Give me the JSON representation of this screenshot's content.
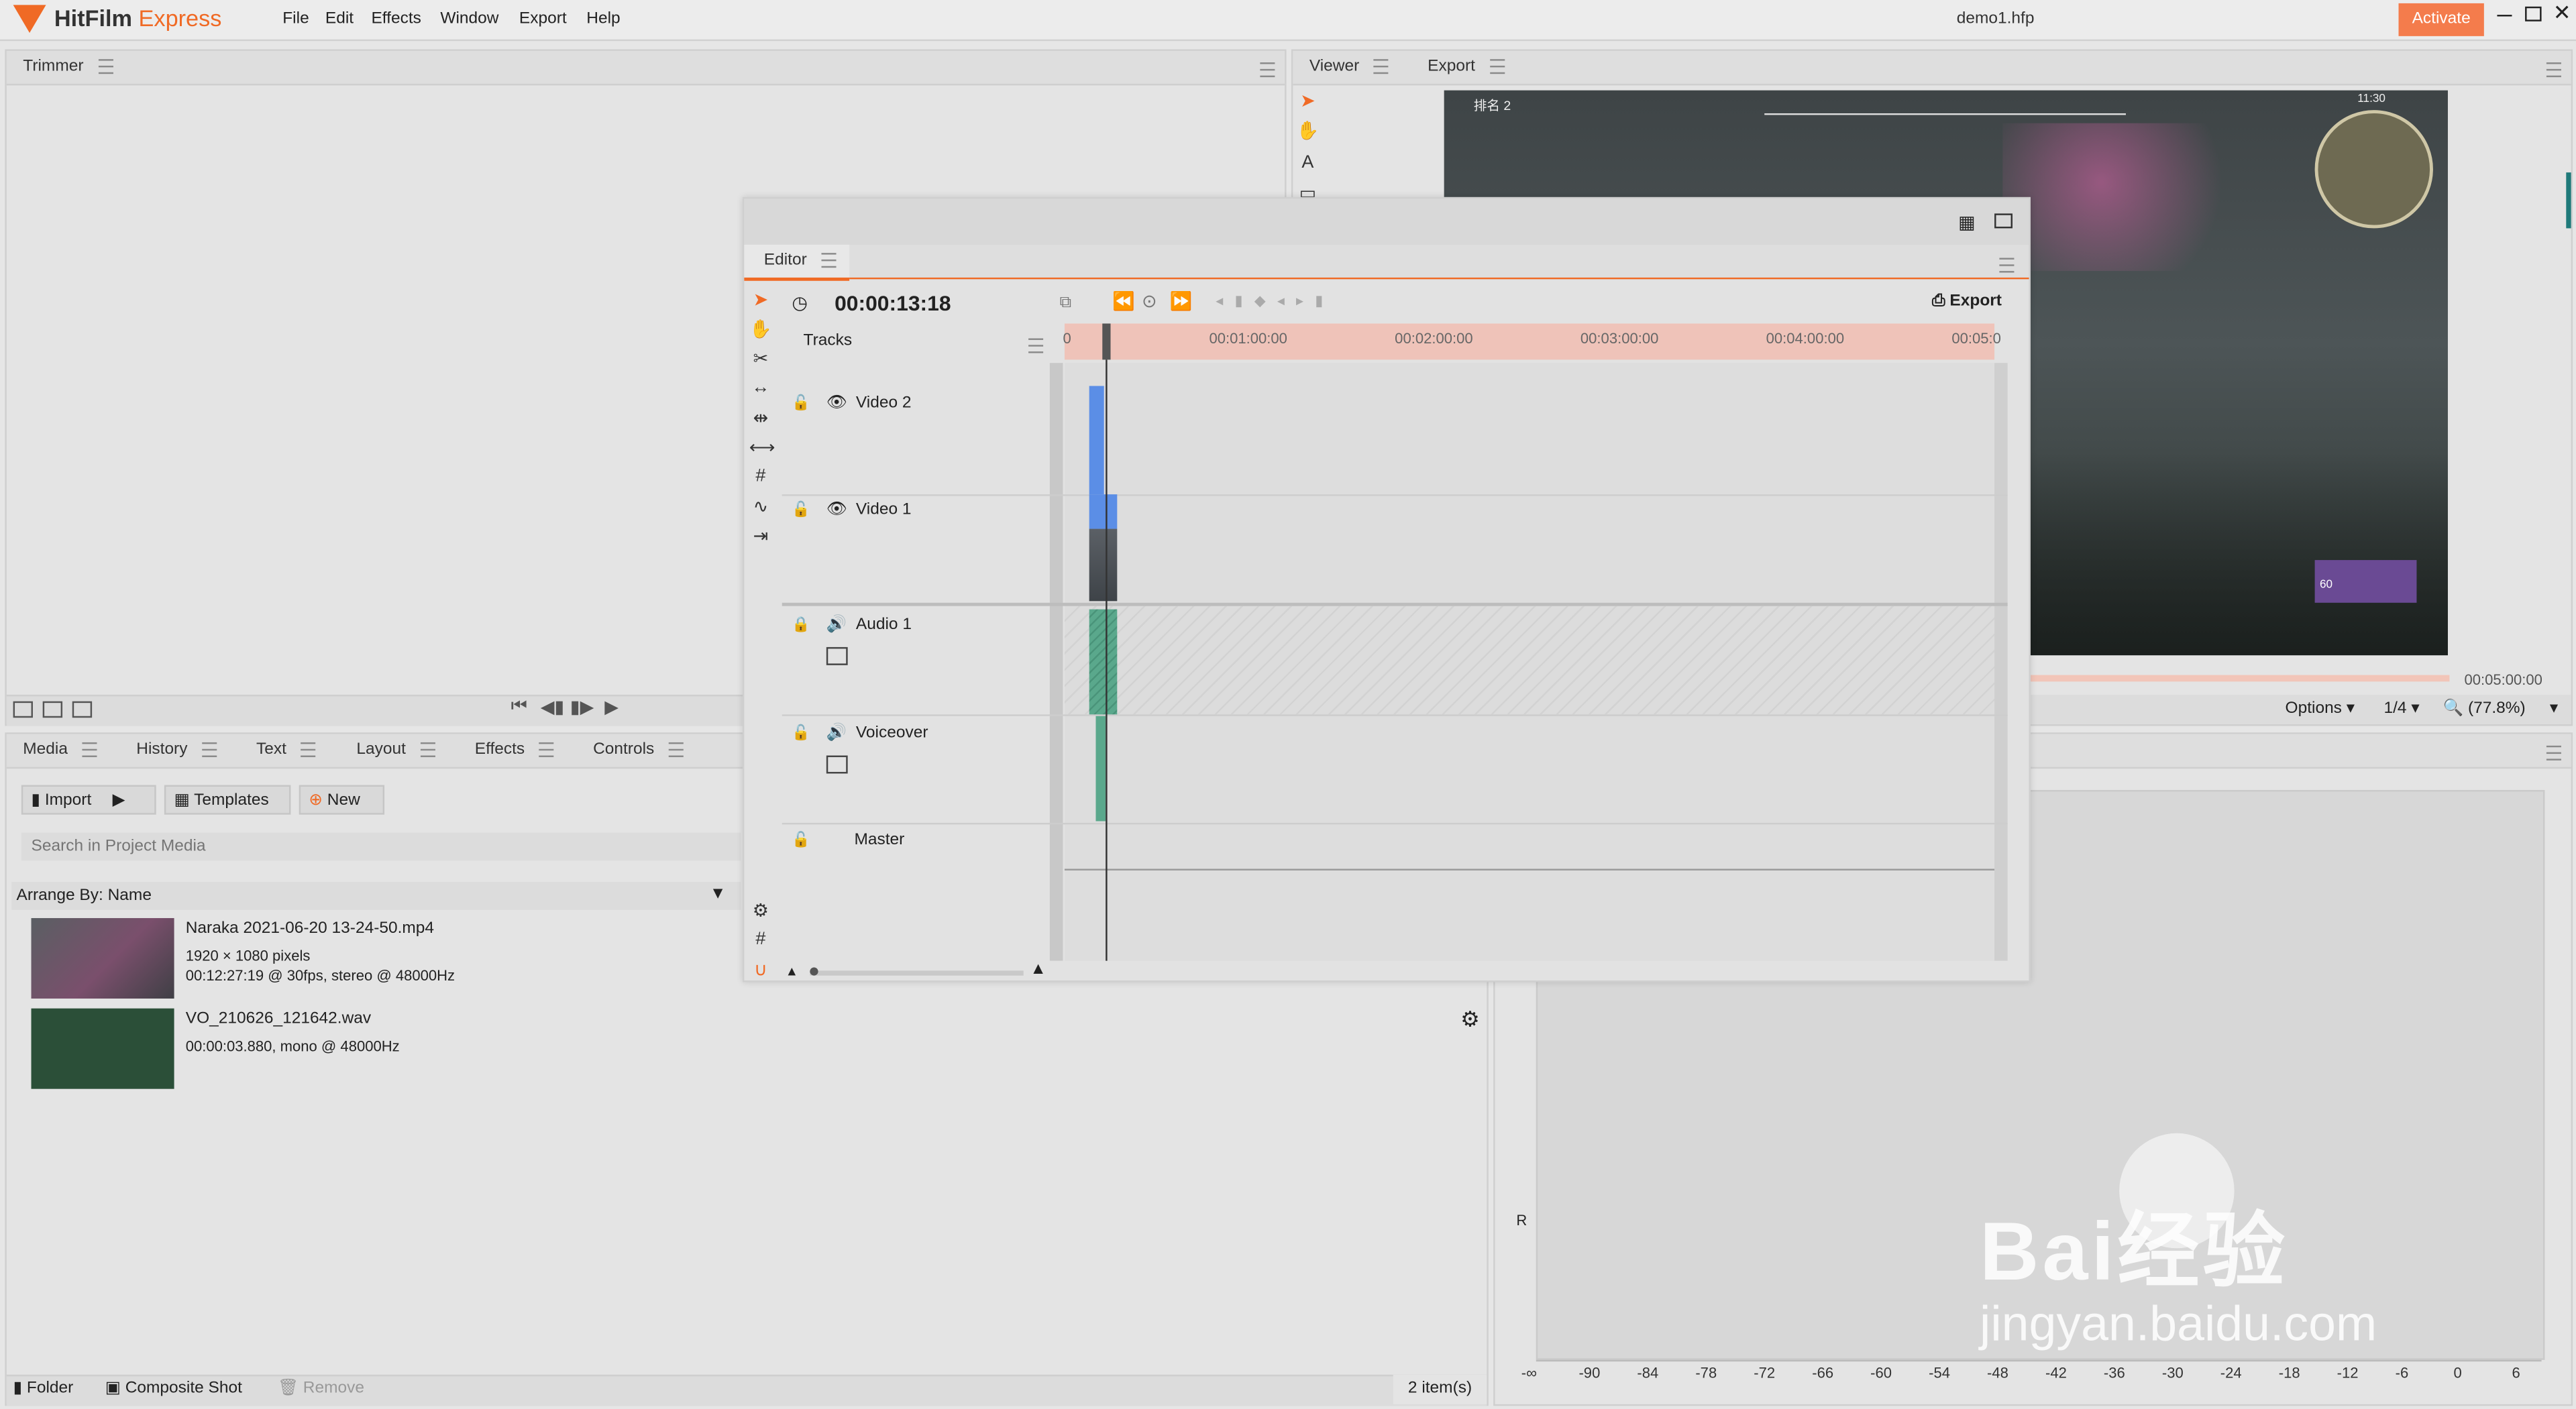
{
  "app": {
    "logo_text": "HitFilm",
    "logo_accent": "Express",
    "menu": [
      "File",
      "Edit",
      "Effects",
      "Window",
      "Export",
      "Help"
    ],
    "file_name": "demo1.hfp",
    "activate_label": "Activate",
    "brand_color": "#f06a25"
  },
  "trimmer": {
    "tab": "Trimmer"
  },
  "viewer": {
    "tabs": [
      "Viewer",
      "Export"
    ],
    "duration": "00:05:00:00",
    "options_label": "Options",
    "resolution": "1/4",
    "zoom": "(77.8%)",
    "hud_rank": "排名 2",
    "hud_time": "11:30",
    "hud_ammo": "60"
  },
  "editor": {
    "tab": "Editor",
    "timecode": "00:00:13:18",
    "export_label": "Export",
    "tracks_header": "Tracks",
    "ruler": [
      "0",
      "00:01:00:00",
      "00:02:00:00",
      "00:03:00:00",
      "00:04:00:00",
      "00:05:0"
    ],
    "tracks": [
      "Video 2",
      "Video 1",
      "Audio 1",
      "Voiceover",
      "Master"
    ]
  },
  "media": {
    "tabs": [
      "Media",
      "History",
      "Text",
      "Layout",
      "Effects",
      "Controls"
    ],
    "import_label": "Import",
    "templates_label": "Templates",
    "new_label": "New",
    "search_placeholder": "Search in Project Media",
    "arrange_label": "Arrange By: Name",
    "items": [
      {
        "name": "Naraka 2021-06-20 13-24-50.mp4",
        "line1": "1920 × 1080 pixels",
        "line2": "00:12:27:19 @ 30fps, stereo @ 48000Hz"
      },
      {
        "name": "VO_210626_121642.wav",
        "line1": "00:00:03.880, mono @ 48000Hz",
        "line2": ""
      }
    ],
    "footer": {
      "folder": "Folder",
      "composite": "Composite Shot",
      "remove": "Remove",
      "count": "2 item(s)"
    }
  },
  "meters": {
    "channel_label": "R",
    "ticks": [
      "-∞",
      "-90",
      "-84",
      "-78",
      "-72",
      "-66",
      "-60",
      "-54",
      "-48",
      "-42",
      "-36",
      "-30",
      "-24",
      "-18",
      "-12",
      "-6",
      "0",
      "6"
    ]
  },
  "watermark": {
    "brand": "Bai经验",
    "url": "jingyan.baidu.com"
  }
}
